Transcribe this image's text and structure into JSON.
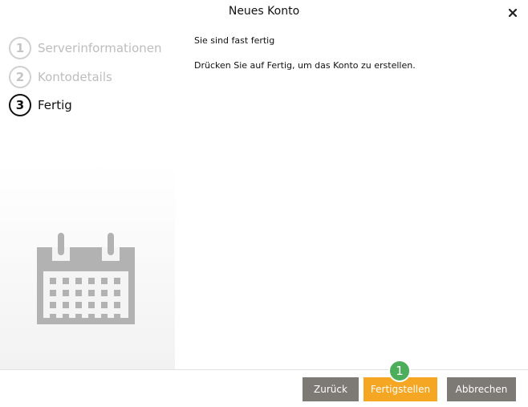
{
  "window": {
    "title": "Neues Konto",
    "close_icon": "close-icon"
  },
  "steps": [
    {
      "number": "1",
      "label": "Serverinformationen",
      "state": "done"
    },
    {
      "number": "2",
      "label": "Kontodetails",
      "state": "done"
    },
    {
      "number": "3",
      "label": "Fertig",
      "state": "active"
    }
  ],
  "sidebar": {
    "illustration_icon": "calendar-icon"
  },
  "main": {
    "heading": "Sie sind fast fertig",
    "message": "Drücken Sie auf Fertig, um das Konto zu erstellen."
  },
  "footer": {
    "back_label": "Zurück",
    "finish_label": "Fertigstellen",
    "cancel_label": "Abbrechen"
  },
  "badge": {
    "label": "1"
  },
  "colors": {
    "accent": "#f5a623",
    "neutral_button": "#7d7a75",
    "badge": "#4cae5a"
  }
}
